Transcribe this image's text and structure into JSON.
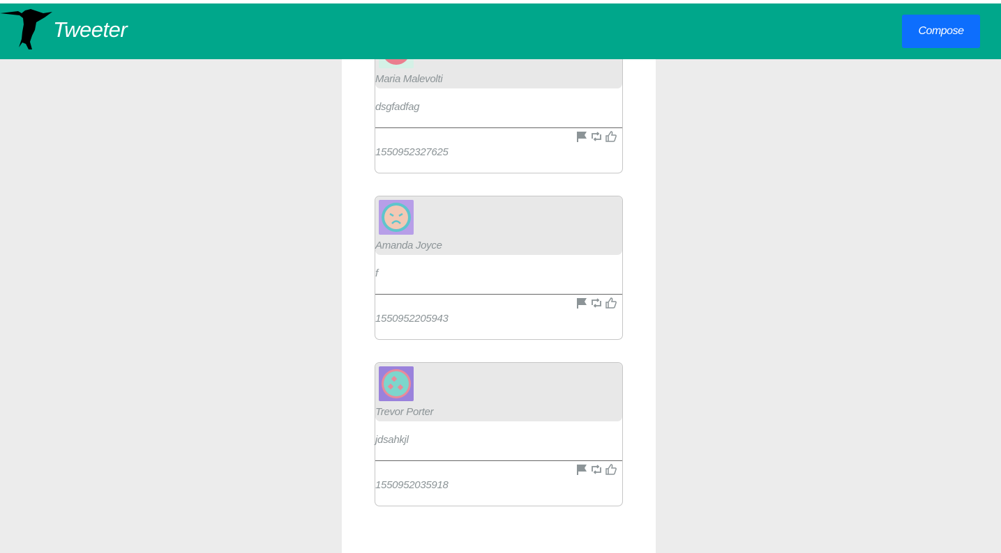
{
  "navbar": {
    "brand": "Tweeter",
    "compose_label": "Compose",
    "logo_icon": "hummingbird-icon",
    "background_color": "#00a78b",
    "compose_color": "#0d6efd"
  },
  "tweets": [
    {
      "author": "Maria Malevolti",
      "content": "dsgfadfag",
      "timestamp": "1550952327625",
      "avatar_icon": "avatar-icon"
    },
    {
      "author": "Amanda Joyce",
      "content": "f",
      "timestamp": "1550952205943",
      "avatar_icon": "avatar-icon"
    },
    {
      "author": "Trevor Porter",
      "content": "jdsahkjl",
      "timestamp": "1550952035918",
      "avatar_icon": "avatar-icon"
    }
  ],
  "actions": {
    "flag_icon": "flag-icon",
    "retweet_icon": "retweet-icon",
    "like_icon": "like-icon"
  }
}
